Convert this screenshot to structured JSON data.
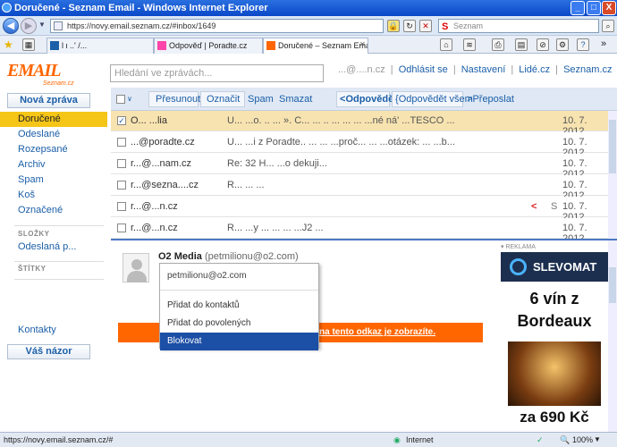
{
  "window": {
    "title": "Doručené - Seznam Email - Windows Internet Explorer",
    "controls": {
      "minimize": "_",
      "maximize": "□",
      "close": "X"
    }
  },
  "addressbar": {
    "url": "https://novy.email.seznam.cz/#inbox/1649",
    "search_placeholder": "Seznam"
  },
  "tabs": [
    {
      "label": "l                 ι           ..'          /..."
    },
    {
      "label": "Odpověď | Poradte.cz"
    },
    {
      "label": "Doručené – Seznam Email"
    }
  ],
  "app": {
    "logo_text": "EMAIL",
    "logo_sub": "Seznam.cz",
    "search_placeholder": "Hledání ve zprávách...",
    "topnav": {
      "user": "...@....n.cz",
      "logout": "Odhlásit se",
      "settings": "Nastavení",
      "people": "Lidé.cz",
      "seznam": "Seznam.cz"
    },
    "new_message": "Nová zpráva",
    "folders": [
      "Doručené",
      "Odeslané",
      "Rozepsané",
      "Archiv",
      "Spam",
      "Koš",
      "Označené"
    ],
    "section_folders": "SLOŽKY",
    "custom_folders": [
      "Odeslaná p..."
    ],
    "section_labels": "ŠTÍTKY",
    "contacts": "Kontakty",
    "feedback": "Váš názor",
    "toolbar": {
      "move": "Přesunout",
      "mark": "Označit",
      "spam": "Spam",
      "delete": "Smazat",
      "reply": "Odpovědět",
      "reply_all": "Odpovědět všem",
      "forward": "Přeposlat"
    },
    "messages": [
      {
        "from": "O... ...lia",
        "subject": "U... ...o. ..    ... ». C...  ... ..  ...  ...  ...  ...né ná'  ...TESCO ...",
        "date": "10. 7. 2012",
        "checked": "✓"
      },
      {
        "from": "...@poradte.cz",
        "subject": "U...   ...i z Poradte..   ...  ...  ...proč...  ...  ...otázek:  ...   ...b...",
        "date": "10. 7. 2012",
        "checked": ""
      },
      {
        "from": "r...@...nam.cz",
        "subject": "Re: 32 H...  ...o dekuji...",
        "date": "10. 7. 2012",
        "checked": ""
      },
      {
        "from": "r...@sezna....cz",
        "subject": "R...  ...  ...",
        "date": "10. 7. 2012",
        "checked": ""
      },
      {
        "from": "r...@...n.cz",
        "subject": "",
        "date": "10. 7. 2012",
        "checked": "",
        "flag": "<",
        "s": "S"
      },
      {
        "from": "r...@...n.cz",
        "subject": "R... ...y ...  ...  ...  ...J2 ...",
        "date": "10. 7. 2012",
        "checked": ""
      }
    ],
    "preview": {
      "sender_name": "O2 Media",
      "sender_email": "(petmilionu@o2.com)",
      "banner_text": "na tento odkaz je zobrazíte."
    },
    "dropdown": {
      "header": "petmilionu@o2.com",
      "items": [
        "Přidat do kontaktů",
        "Přidat do povolených",
        "Blokovat"
      ]
    },
    "ad": {
      "label": "▾ REKLAMA",
      "brand": "SLEVOMAT",
      "line1": "6 vín z",
      "line2": "Bordeaux",
      "line3": "za 690 Kč"
    }
  },
  "statusbar": {
    "url": "https://novy.email.seznam.cz/#",
    "zone": "Internet",
    "zoom": "100%"
  },
  "colors": {
    "accent": "#f60",
    "selected_folder": "#f5c518",
    "link": "#1b5fa8",
    "menu_highlight": "#1c4fa6"
  }
}
